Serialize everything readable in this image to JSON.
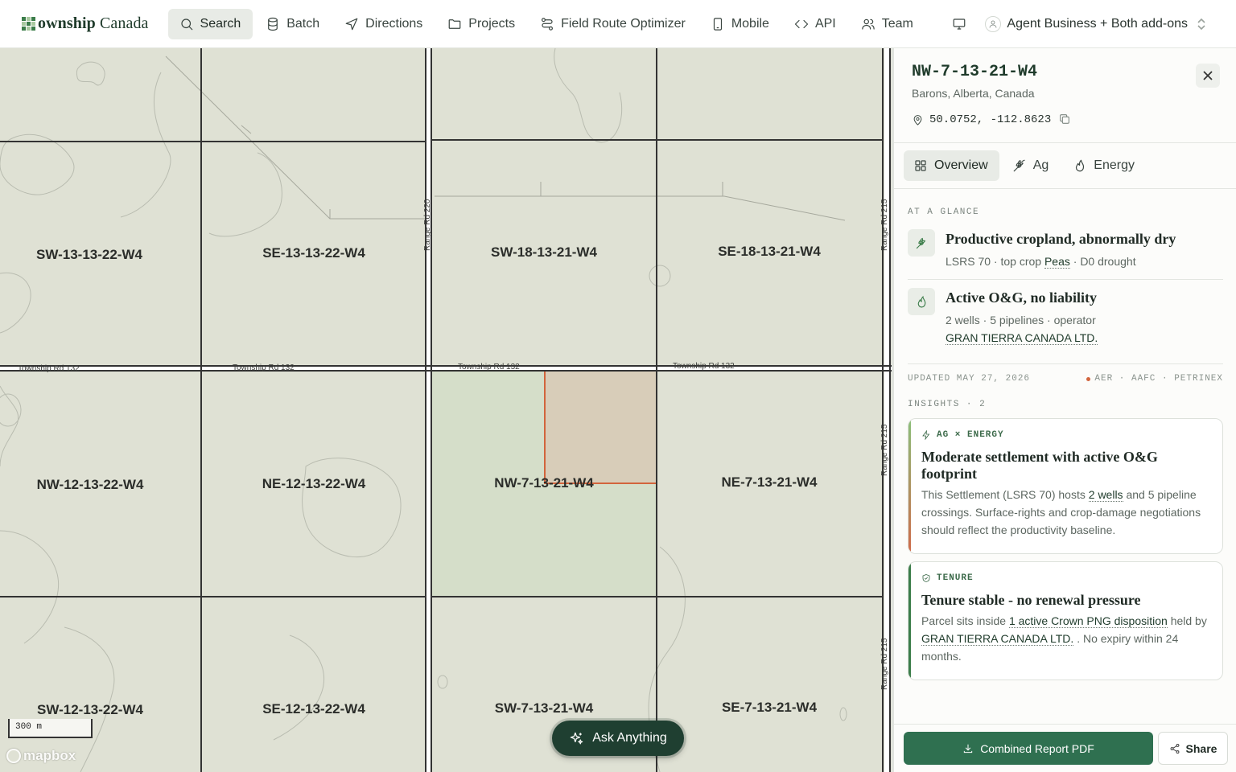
{
  "brand": {
    "bold": "ownship",
    "rest": " Canada"
  },
  "nav": [
    {
      "label": "Search",
      "icon": "search-icon"
    },
    {
      "label": "Batch",
      "icon": "database-icon"
    },
    {
      "label": "Directions",
      "icon": "navigation-icon"
    },
    {
      "label": "Projects",
      "icon": "folder-icon"
    },
    {
      "label": "Field Route Optimizer",
      "icon": "route-icon"
    },
    {
      "label": "Mobile",
      "icon": "mobile-icon"
    },
    {
      "label": "API",
      "icon": "code-icon"
    },
    {
      "label": "Team",
      "icon": "users-icon"
    }
  ],
  "account": {
    "label": "Agent Business + Both add-ons"
  },
  "map": {
    "parcels": {
      "r1c1": "SW-13-13-22-W4",
      "r1c2": "SE-13-13-22-W4",
      "r1c3": "SW-18-13-21-W4",
      "r1c4": "SE-18-13-21-W4",
      "r2c1": "NW-12-13-22-W4",
      "r2c2": "NE-12-13-22-W4",
      "r2c3": "NW-7-13-21-W4",
      "r2c4": "NE-7-13-21-W4",
      "r3c1": "SW-12-13-22-W4",
      "r3c2": "SE-12-13-22-W4",
      "r3c3": "SW-7-13-21-W4",
      "r3c4": "SE-7-13-21-W4"
    },
    "roads": {
      "township": "Township Rd 132",
      "range220": "Range Rd 220",
      "range215": "Range Rd 215"
    },
    "scale": "300 m",
    "attribution": "mapbox",
    "ask_label": "Ask Anything",
    "selected_color": "#d2643c"
  },
  "panel": {
    "title": "NW-7-13-21-W4",
    "location": "Barons, Alberta, Canada",
    "coords": "50.0752, -112.8623",
    "tabs": [
      {
        "label": "Overview",
        "icon": "grid-icon"
      },
      {
        "label": "Ag",
        "icon": "wheat-icon"
      },
      {
        "label": "Energy",
        "icon": "flame-icon"
      }
    ],
    "glance_heading": "AT A GLANCE",
    "glance": [
      {
        "title": "Productive cropland, abnormally dry",
        "pre": "LSRS 70 · top crop ",
        "link": "Peas",
        "post": " · D0 drought"
      },
      {
        "title": "Active O&G, no liability",
        "pre": "2 wells · 5 pipelines · operator",
        "link": "GRAN TIERRA CANADA LTD."
      }
    ],
    "updated": "UPDATED MAY 27, 2026",
    "sources": "AER · AAFC · PETRINEX",
    "insights_heading": "INSIGHTS · 2",
    "insights": [
      {
        "tag": "AG × ENERGY",
        "title": "Moderate settlement with active O&G footprint",
        "pre": "This Settlement (LSRS 70) hosts ",
        "link": "2 wells",
        "post": " and 5 pipeline crossings. Surface-rights and crop-damage negotiations should reflect the productivity baseline."
      },
      {
        "tag": "TENURE",
        "title": "Tenure stable - no renewal pressure",
        "pre": "Parcel sits inside ",
        "link": "1 active Crown PNG disposition",
        "mid": " held by ",
        "link2": "GRAN TIERRA CANADA LTD.",
        "post": " . No expiry within 24 months."
      }
    ],
    "report_label": "Combined Report PDF",
    "share_label": "Share"
  }
}
